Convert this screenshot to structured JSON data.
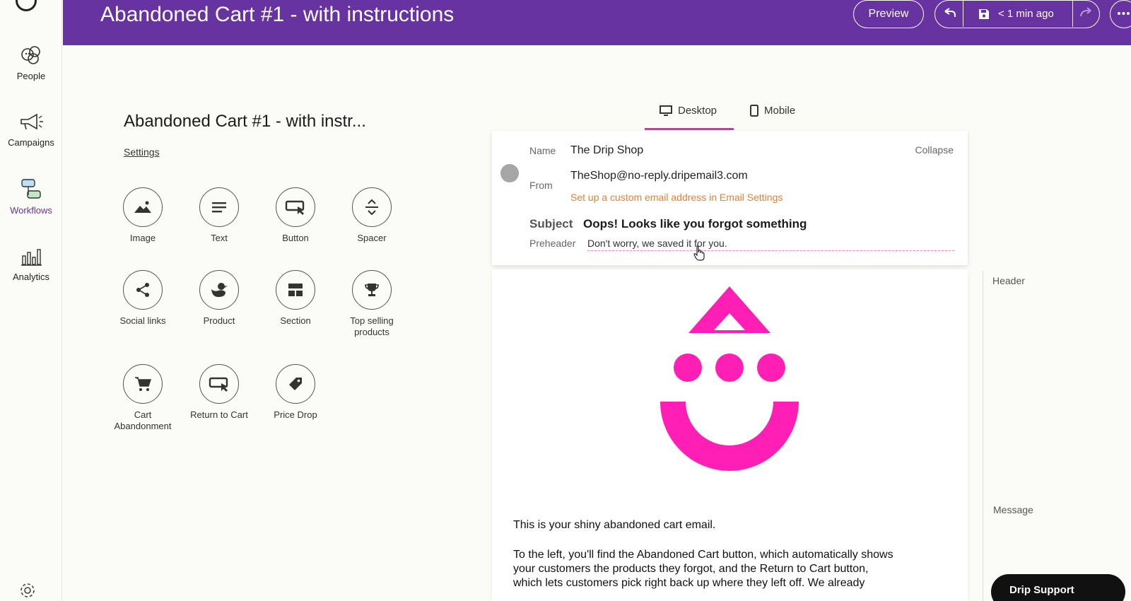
{
  "nav": {
    "items": [
      {
        "label": "People",
        "icon": "people-icon"
      },
      {
        "label": "Campaigns",
        "icon": "megaphone-icon"
      },
      {
        "label": "Workflows",
        "icon": "workflow-icon",
        "active": true
      },
      {
        "label": "Analytics",
        "icon": "analytics-icon"
      }
    ],
    "settings_icon": "gear-icon"
  },
  "topbar": {
    "title": "Abandoned Cart #1 - with instructions",
    "preview_label": "Preview",
    "save_status": "< 1 min ago",
    "color": "#6633a1"
  },
  "builder": {
    "title": "Abandoned Cart #1 - with instr...",
    "settings_label": "Settings",
    "blocks": [
      {
        "label": "Image",
        "icon": "image-icon"
      },
      {
        "label": "Text",
        "icon": "text-icon"
      },
      {
        "label": "Button",
        "icon": "button-icon"
      },
      {
        "label": "Spacer",
        "icon": "spacer-icon"
      },
      {
        "label": "Social links",
        "icon": "share-icon"
      },
      {
        "label": "Product",
        "icon": "product-icon"
      },
      {
        "label": "Section",
        "icon": "section-icon"
      },
      {
        "label": "Top selling products",
        "icon": "trophy-icon"
      },
      {
        "label": "Cart Abandonment",
        "icon": "cart-icon"
      },
      {
        "label": "Return to Cart",
        "icon": "return-to-cart-icon"
      },
      {
        "label": "Price Drop",
        "icon": "price-tag-icon"
      }
    ]
  },
  "tabs": {
    "desktop": "Desktop",
    "mobile": "Mobile",
    "active": "desktop",
    "accent": "#ff1fb4"
  },
  "email_header": {
    "name_label": "Name",
    "name_value": "The Drip Shop",
    "collapse_label": "Collapse",
    "from_label": "From",
    "from_value": "TheShop@no-reply.dripemail3.com",
    "from_hint": "Set up a custom email address in Email Settings",
    "subject_label": "Subject",
    "subject_value": "Oops! Looks like you forgot something",
    "preheader_label": "Preheader",
    "preheader_value": "Don't worry, we saved it for you."
  },
  "email_body": {
    "logo_color": "#ff1fb4",
    "para1": "This is your shiny abandoned cart email.",
    "para2_line1": "To the left, you'll find the Abandoned Cart button, which automatically shows",
    "para2_line2": "your customers the products they forgot, and the Return to Cart button,",
    "para2_line3": "which lets customers pick right back up where they left off. We already"
  },
  "rail": {
    "header_label": "Header",
    "message_label": "Message"
  },
  "help": {
    "label": "Drip Support"
  }
}
